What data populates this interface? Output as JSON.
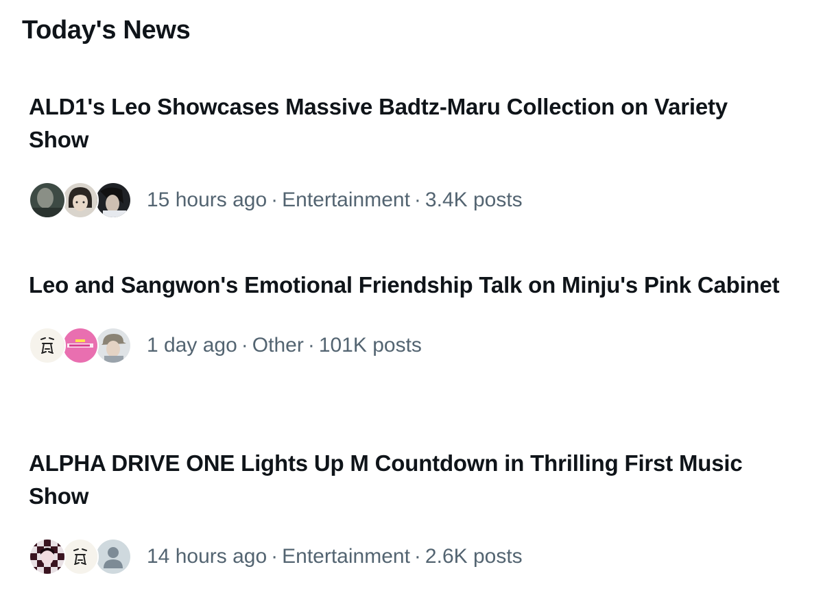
{
  "section": {
    "title": "Today's News"
  },
  "news": [
    {
      "headline": "ALD1's Leo Showcases Massive Badtz-Maru Collection on Variety Show",
      "time": "15 hours ago",
      "category": "Entertainment",
      "posts": "3.4K posts",
      "avatars": [
        "avatar-photo-dark",
        "avatar-photo-face",
        "avatar-photo-profile"
      ]
    },
    {
      "headline": "Leo and Sangwon's Emotional Friendship Talk on Minju's Pink Cabinet",
      "time": "1 day ago",
      "category": "Other",
      "posts": "101K posts",
      "avatars": [
        "avatar-doodle",
        "avatar-pink-logo",
        "avatar-photo-cap"
      ]
    },
    {
      "headline": "ALPHA DRIVE ONE Lights Up M Countdown in Thrilling First Music Show",
      "time": "14 hours ago",
      "category": "Entertainment",
      "posts": "2.6K posts",
      "avatars": [
        "avatar-photo-checkered",
        "avatar-doodle",
        "avatar-default-person"
      ]
    }
  ],
  "separator": "·",
  "colors": {
    "text_primary": "#0f1419",
    "text_secondary": "#536471",
    "accent_pink": "#e96fb0",
    "default_avatar_bg": "#cfd9de"
  }
}
